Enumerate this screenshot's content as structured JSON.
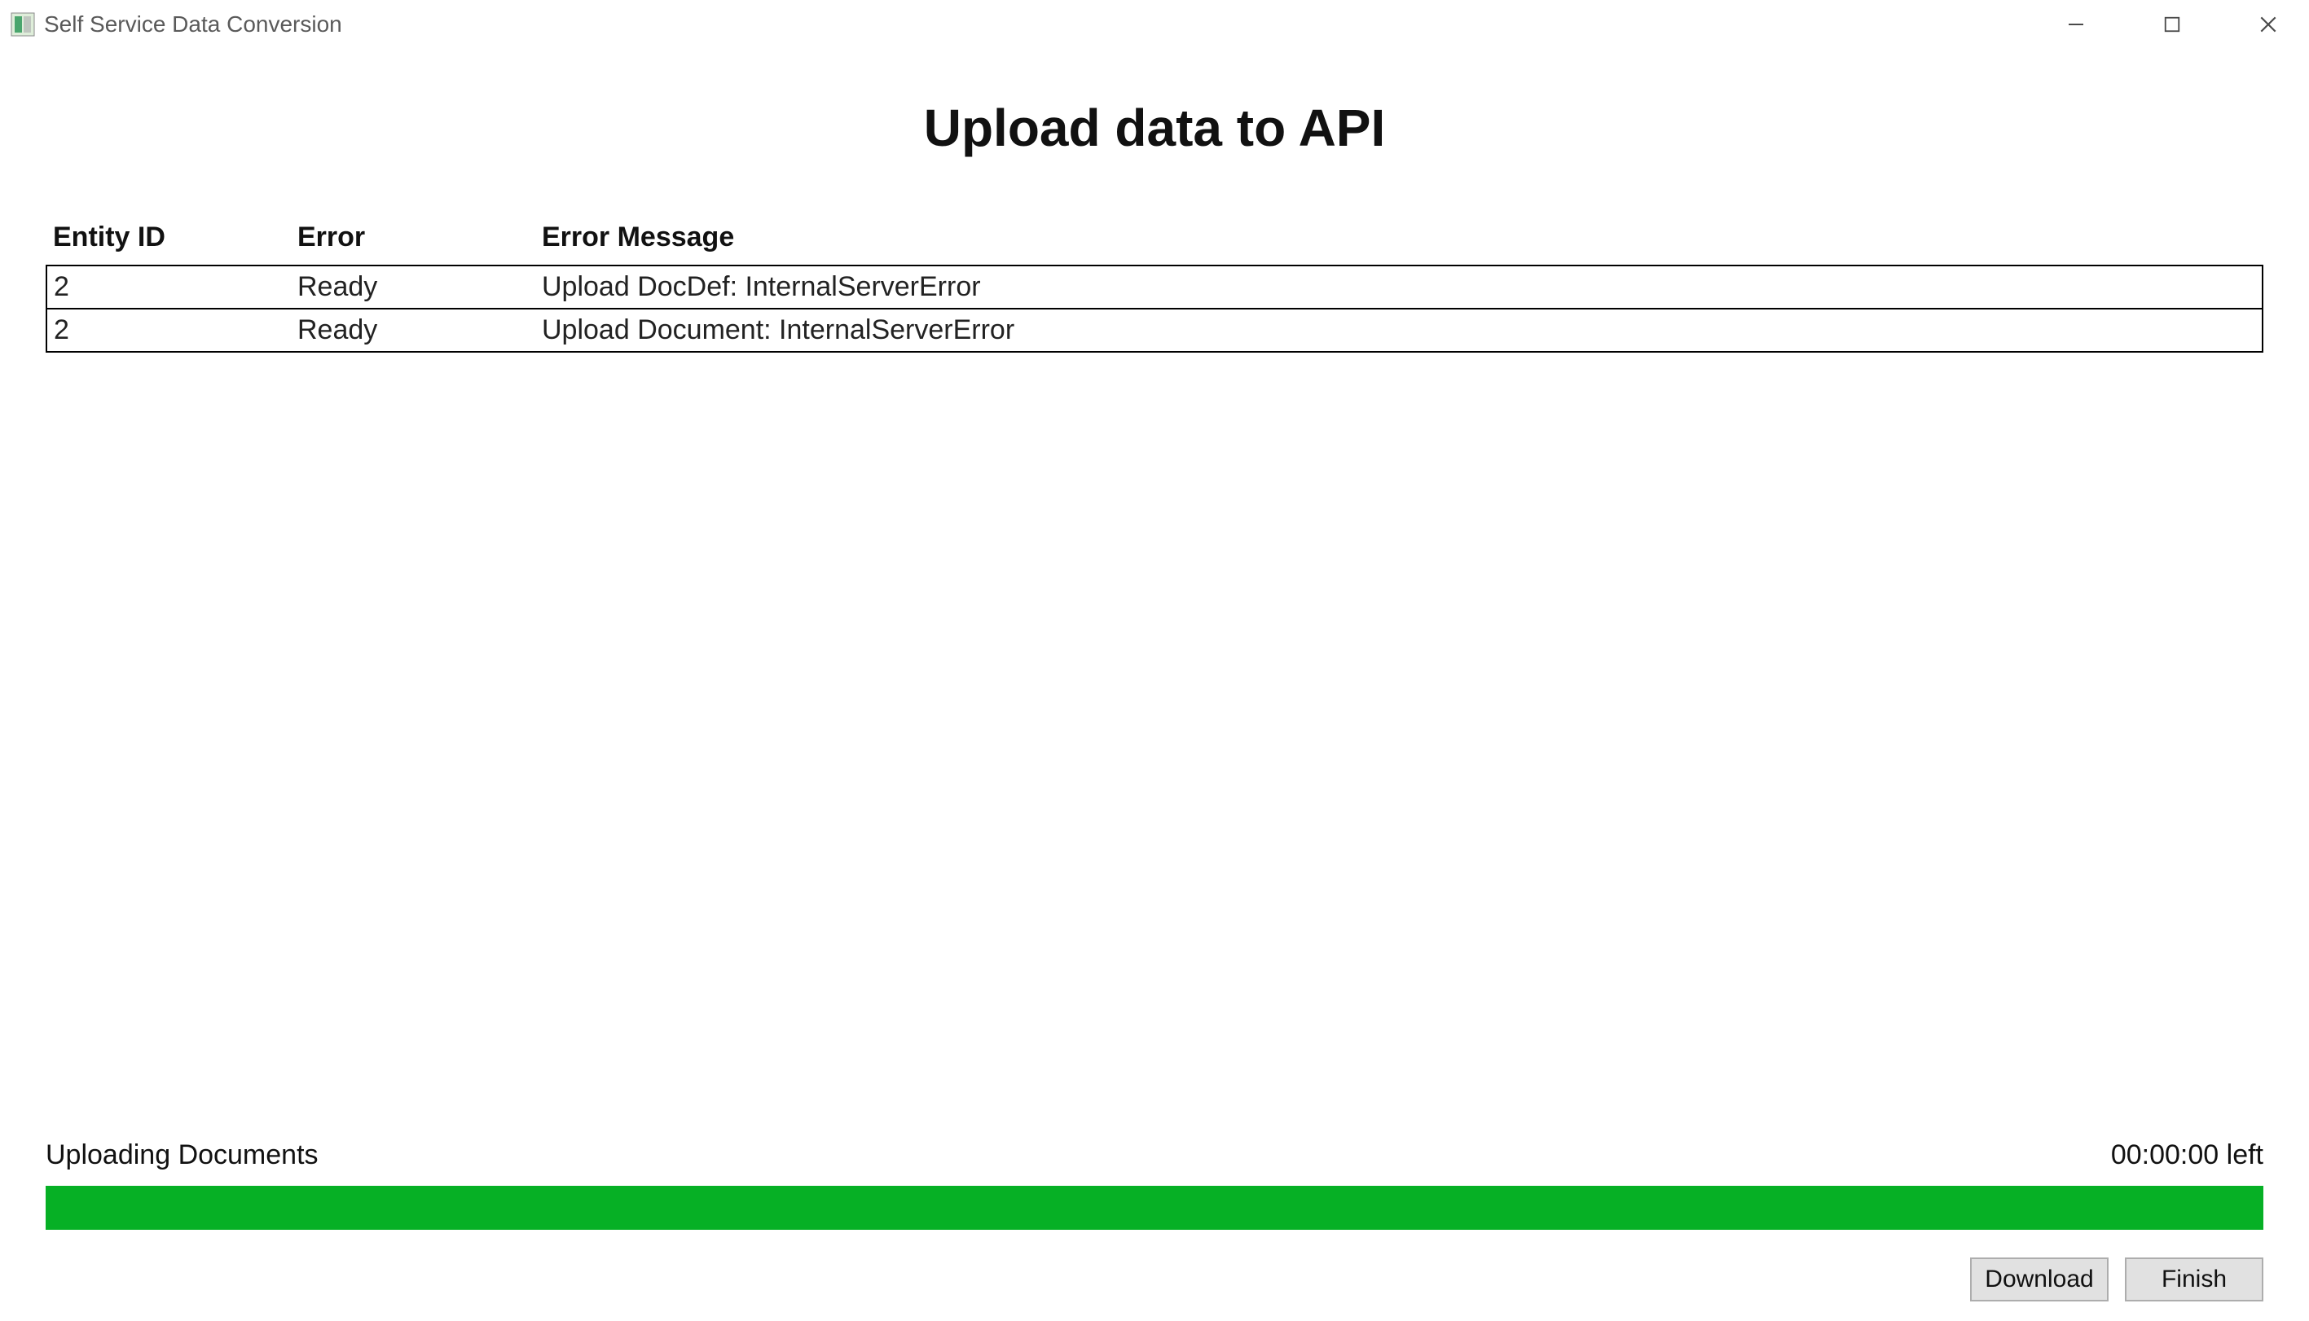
{
  "window": {
    "title": "Self Service Data Conversion"
  },
  "main": {
    "heading": "Upload data to API",
    "table": {
      "columns": [
        "Entity ID",
        "Error",
        "Error Message"
      ],
      "rows": [
        {
          "entity_id": "2",
          "error": "Ready",
          "error_message": "Upload DocDef: InternalServerError"
        },
        {
          "entity_id": "2",
          "error": "Ready",
          "error_message": "Upload Document: InternalServerError"
        }
      ]
    }
  },
  "progress": {
    "status_text": "Uploading Documents",
    "time_left": "00:00:00 left",
    "percent": 100,
    "color": "#06b025"
  },
  "buttons": {
    "download": "Download",
    "finish": "Finish"
  }
}
